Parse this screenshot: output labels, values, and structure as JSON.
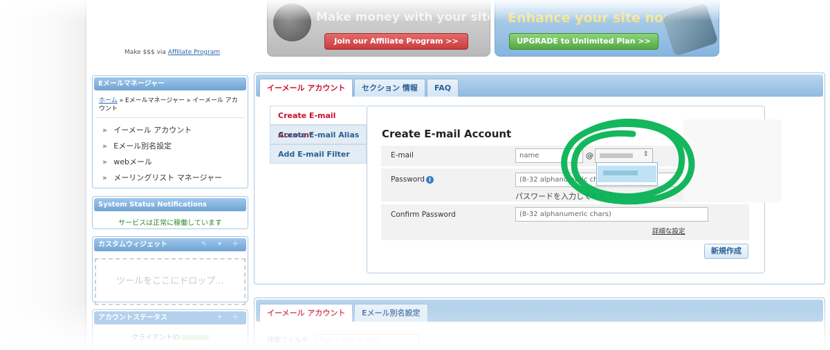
{
  "header": {
    "affiliate_prefix": "Make $$$ via",
    "affiliate_link": "Affiliate Program",
    "banner_affiliate": {
      "headline": "Make money with your site!",
      "button": "Join our Affiliate Program >>"
    },
    "banner_upgrade": {
      "headline": "Enhance your site now!",
      "button": "UPGRADE to Unlimited Plan >>"
    }
  },
  "sidebar": {
    "email_manager": {
      "title": "Eメールマネージャー",
      "breadcrumb_home": "ホーム",
      "breadcrumb_rest": " » Eメールマネージャー » イーメール アカウント",
      "items": [
        {
          "label": "イーメール アカウント"
        },
        {
          "label": "Eメール別名設定"
        },
        {
          "label": "webメール"
        },
        {
          "label": "メーリングリスト マネージャー"
        }
      ]
    },
    "system_status": {
      "title": "System Status Notifications",
      "message": "サービスは正常に稼働しています"
    },
    "custom_widget": {
      "title": "カスタムウィジェット",
      "drop_text": "ツールをここにドロップ...",
      "tools": "✎ ✦ ✢"
    },
    "account_status": {
      "title": "アカウントステータス",
      "client_id_label": "クライアントID",
      "tools": "✦ ✢"
    }
  },
  "main": {
    "tabs": [
      {
        "label": "イーメール アカウント",
        "active": true
      },
      {
        "label": "セクション 情報",
        "active": false
      },
      {
        "label": "FAQ",
        "active": false
      }
    ],
    "subnav": [
      {
        "label": "Create E-mail Account",
        "active": true
      },
      {
        "label": "Create E-mail Alias",
        "active": false
      },
      {
        "label": "Add E-mail Filter",
        "active": false
      }
    ],
    "form": {
      "title": "Create E-mail Account",
      "email_label": "E-mail",
      "email_placeholder": "name",
      "at_sign": "@",
      "password_label": "Password",
      "password_placeholder": "(8-32 alphanumeric chars)",
      "password_hint": "パスワードを入力してください",
      "confirm_label": "Confirm Password",
      "confirm_placeholder": "(8-32 alphanumeric chars)",
      "advanced_link": "詳細な設定",
      "create_button": "新規作成"
    }
  },
  "second_panel": {
    "tabs": [
      {
        "label": "イーメール アカウント",
        "active": true
      },
      {
        "label": "Eメール別名設定",
        "active": false
      }
    ],
    "filter_label": "検索フィルタ:",
    "filter_placeholder": "Type e-mail to filter"
  },
  "colors": {
    "accent_red": "#c8102e",
    "link_blue": "#2a66a8",
    "panel_blue": "#8fbbe2",
    "annotation_green": "#00b14f"
  }
}
